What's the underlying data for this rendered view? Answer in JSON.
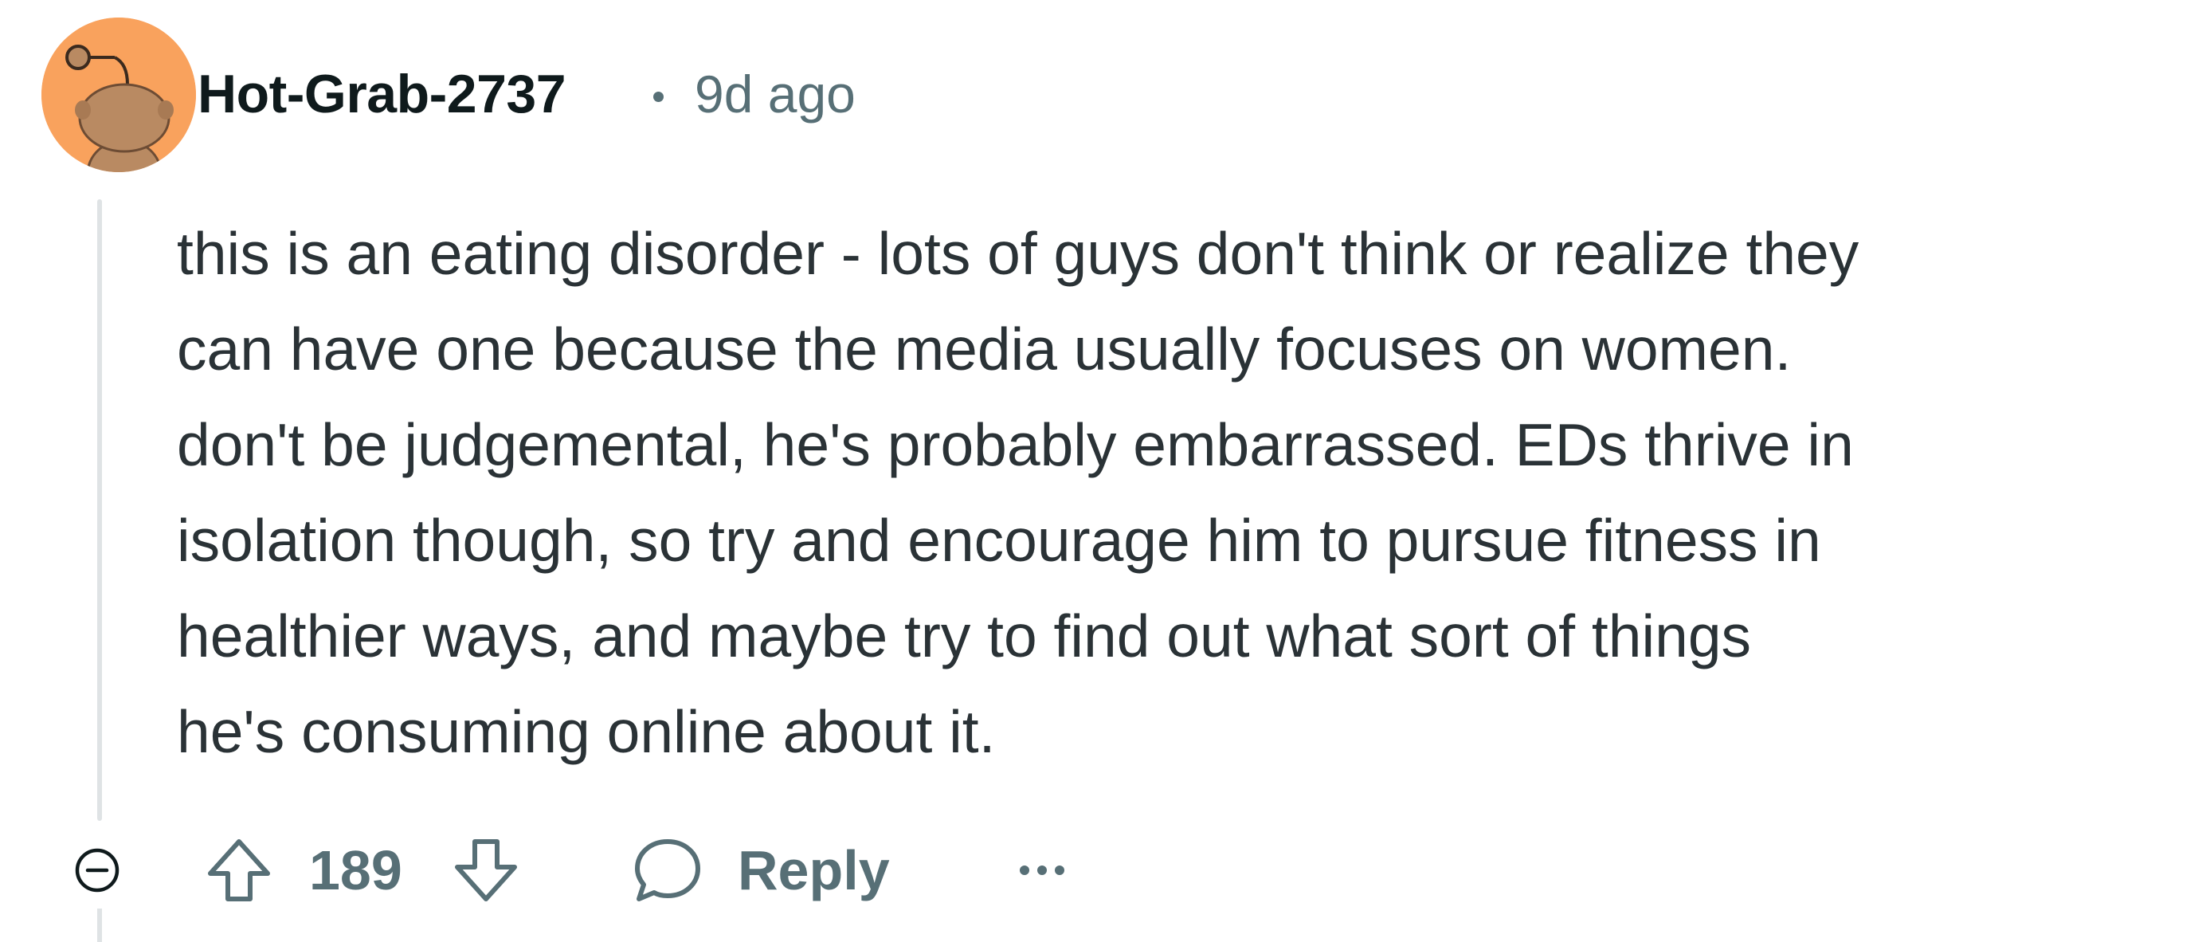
{
  "comment": {
    "author": "Hot-Grab-2737",
    "separator": "•",
    "timestamp": "9d ago",
    "body_lines": [
      "this is an eating disorder - lots of guys don't think or realize they",
      "can have one because the media usually focuses on women.",
      "don't be judgemental, he's probably embarrassed. EDs thrive in",
      "isolation though, so try and encourage him to pursue fitness in",
      "healthier ways, and maybe try to find out what sort of things",
      "he's consuming online about it."
    ],
    "avatar_bg": "#f9a25d"
  },
  "actions": {
    "vote_count": "189",
    "reply_label": "Reply",
    "icons": {
      "collapse": "collapse-icon",
      "upvote": "upvote-arrow-icon",
      "downvote": "downvote-arrow-icon",
      "reply": "speech-bubble-icon",
      "more": "ellipsis-icon"
    }
  },
  "colors": {
    "text": "#2a3236",
    "username": "#0f1a1c",
    "muted": "#576f76",
    "thread_line": "#dfe3e5"
  }
}
